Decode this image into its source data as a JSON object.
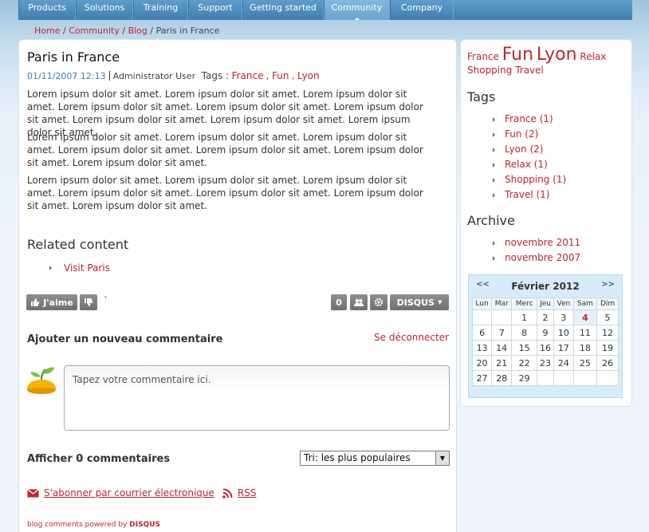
{
  "nav": {
    "items": [
      "Products",
      "Solutions",
      "Training",
      "Support",
      "Getting started",
      "Community",
      "Company"
    ],
    "active": "Community"
  },
  "breadcrumb": {
    "home": "Home",
    "community": "Community",
    "blog": "Blog",
    "current": "Paris in France",
    "sep": " / "
  },
  "post": {
    "title": "Paris in France",
    "date": "01/11/2007 12:13",
    "author": "Administrator User",
    "tags_label": "Tags :",
    "tags": [
      "France",
      "Fun",
      "Lyon"
    ],
    "paragraphs": [
      "Lorem ipsum dolor sit amet. Lorem ipsum dolor sit amet. Lorem ipsum dolor sit amet. Lorem ipsum dolor sit amet. Lorem ipsum dolor sit amet. Lorem ipsum dolor sit amet. Lorem ipsum dolor sit amet. Lorem ipsum dolor sit amet. Lorem ipsum dolor sit amet.",
      "Lorem ipsum dolor sit amet. Lorem ipsum dolor sit amet. Lorem ipsum dolor sit amet. Lorem ipsum dolor sit amet. Lorem ipsum dolor sit amet. Lorem ipsum dolor sit amet. Lorem ipsum dolor sit amet.",
      "Lorem ipsum dolor sit amet. Lorem ipsum dolor sit amet. Lorem ipsum dolor sit amet. Lorem ipsum dolor sit amet. Lorem ipsum dolor sit amet. Lorem ipsum dolor sit amet. Lorem ipsum dolor sit amet."
    ]
  },
  "related": {
    "heading": "Related content",
    "items": [
      "Visit Paris"
    ]
  },
  "disqus": {
    "like_label": "J'aime",
    "count": "0",
    "brand": "DISQUS",
    "tick": "`",
    "add_comment_heading": "Ajouter un nouveau commentaire",
    "logout": "Se déconnecter",
    "comment_placeholder": "Tapez votre commentaire ici.",
    "show_comments": "Afficher 0 commentaires",
    "sort_selected": "Tri: les plus populaires",
    "subscribe_email": "S'abonner par courrier électronique",
    "rss": "RSS",
    "powered_text": "blog comments powered by",
    "powered_brand": "DISQUS"
  },
  "sidebar": {
    "cloud": [
      {
        "label": "France",
        "weight": 1
      },
      {
        "label": "Fun",
        "weight": 2
      },
      {
        "label": "Lyon",
        "weight": 2
      },
      {
        "label": "Relax",
        "weight": 1
      },
      {
        "label": "Shopping",
        "weight": 1
      },
      {
        "label": "Travel",
        "weight": 1
      }
    ],
    "tags_heading": "Tags",
    "tags": [
      "France (1)",
      "Fun (2)",
      "Lyon (2)",
      "Relax (1)",
      "Shopping (1)",
      "Travel (1)"
    ],
    "archive_heading": "Archive",
    "archive": [
      "novembre 2011",
      "novembre 2007"
    ]
  },
  "calendar": {
    "prev": "<<",
    "next": ">>",
    "title": "Février 2012",
    "days": [
      "Lun",
      "Mar",
      "Merc",
      "Jeu",
      "Ven",
      "Sam",
      "Dim"
    ],
    "weeks": [
      [
        "",
        "",
        "1",
        "2",
        "3",
        "4",
        "5"
      ],
      [
        "6",
        "7",
        "8",
        "9",
        "10",
        "11",
        "12"
      ],
      [
        "13",
        "14",
        "15",
        "16",
        "17",
        "18",
        "19"
      ],
      [
        "20",
        "21",
        "22",
        "23",
        "24",
        "25",
        "26"
      ],
      [
        "27",
        "28",
        "29",
        "",
        "",
        "",
        ""
      ]
    ],
    "today": "4"
  },
  "colors": {
    "link": "#c0262c",
    "accent": "#3b7fb8",
    "nav": "#4a88b9"
  }
}
